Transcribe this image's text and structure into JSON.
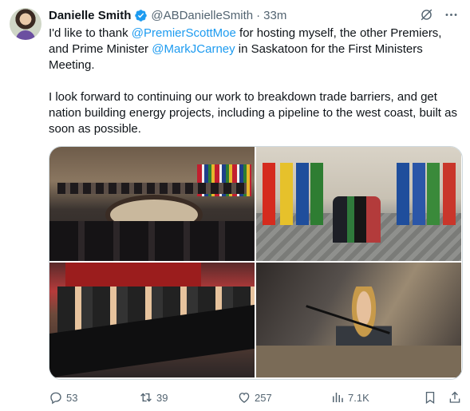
{
  "author": {
    "name": "Danielle Smith",
    "handle": "@ABDanielleSmith",
    "separator": "·",
    "time": "33m"
  },
  "text": {
    "p1_before": "I'd like to thank ",
    "p1_mention1": "@PremierScottMoe",
    "p1_mid": " for hosting myself, the other Premiers, and Prime Minister ",
    "p1_mention2": "@MarkJCarney",
    "p1_after": " in Saskatoon for the First Ministers Meeting.",
    "p2": "I look forward to continuing our work to breakdown trade barriers, and get nation building energy projects, including a pipeline to the west coast, built as soon as possible."
  },
  "actions": {
    "replies": "53",
    "reposts": "39",
    "likes": "257",
    "views": "7.1K"
  },
  "colors": {
    "accent": "#1d9bf0",
    "muted": "#536471",
    "text": "#0f1419"
  },
  "icons": [
    "verified-badge-icon",
    "grok-icon",
    "more-icon",
    "reply-icon",
    "repost-icon",
    "like-icon",
    "views-icon",
    "bookmark-icon",
    "share-icon"
  ]
}
